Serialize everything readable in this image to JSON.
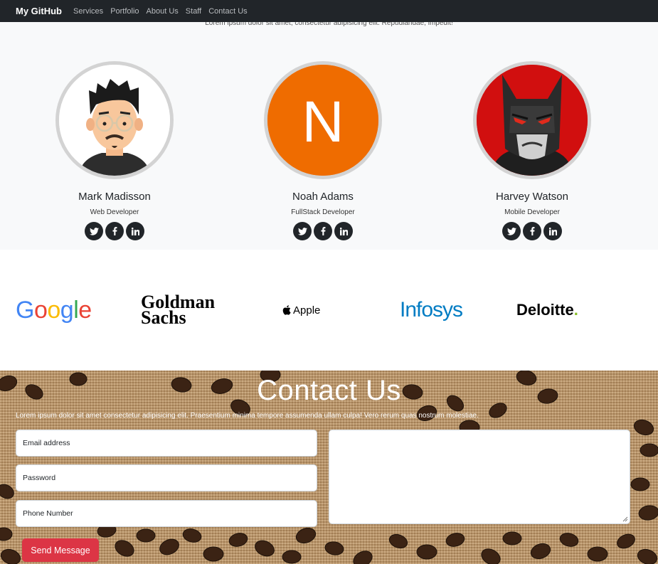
{
  "navbar": {
    "brand": "My GitHub",
    "links": [
      "Services",
      "Portfolio",
      "About Us",
      "Staff",
      "Contact Us"
    ]
  },
  "staff": {
    "subtitle": "Lorem ipsum dolor sit amet, consectetur adipisicing elit. Repudiandae, impedit!",
    "members": [
      {
        "name": "Mark Madisson",
        "role": "Web Developer",
        "avatar": "cartoon-man-glasses"
      },
      {
        "name": "Noah Adams",
        "role": "FullStack Developer",
        "avatar": "letter-n",
        "initial": "N",
        "color": "#ef6c00"
      },
      {
        "name": "Harvey Watson",
        "role": "Mobile Developer",
        "avatar": "batman-cartoon",
        "color": "#d10f0f"
      }
    ],
    "social_icons": [
      "twitter-icon",
      "facebook-icon",
      "linkedin-icon"
    ]
  },
  "clients": {
    "logos": [
      "Google",
      "Goldman Sachs",
      "Apple",
      "Infosys",
      "Deloitte"
    ],
    "goldman_line1": "Goldman",
    "goldman_line2": "Sachs",
    "apple_text": "Apple",
    "deloitte_text": "Deloitte",
    "deloitte_dot": "."
  },
  "contact": {
    "title": "Contact Us",
    "description": "Lorem ipsum dolor sit amet consectetur adipisicing elit. Praesentium minima tempore assumenda ullam culpa! Vero rerum quas nostrum molestiae.",
    "email_placeholder": "Email address",
    "password_placeholder": "Password",
    "phone_placeholder": "Phone Number",
    "send_label": "Send Message"
  },
  "colors": {
    "navbar": "#212529",
    "send_button": "#dc3545",
    "infosys": "#007cc3",
    "deloitte_dot": "#86bc25"
  }
}
